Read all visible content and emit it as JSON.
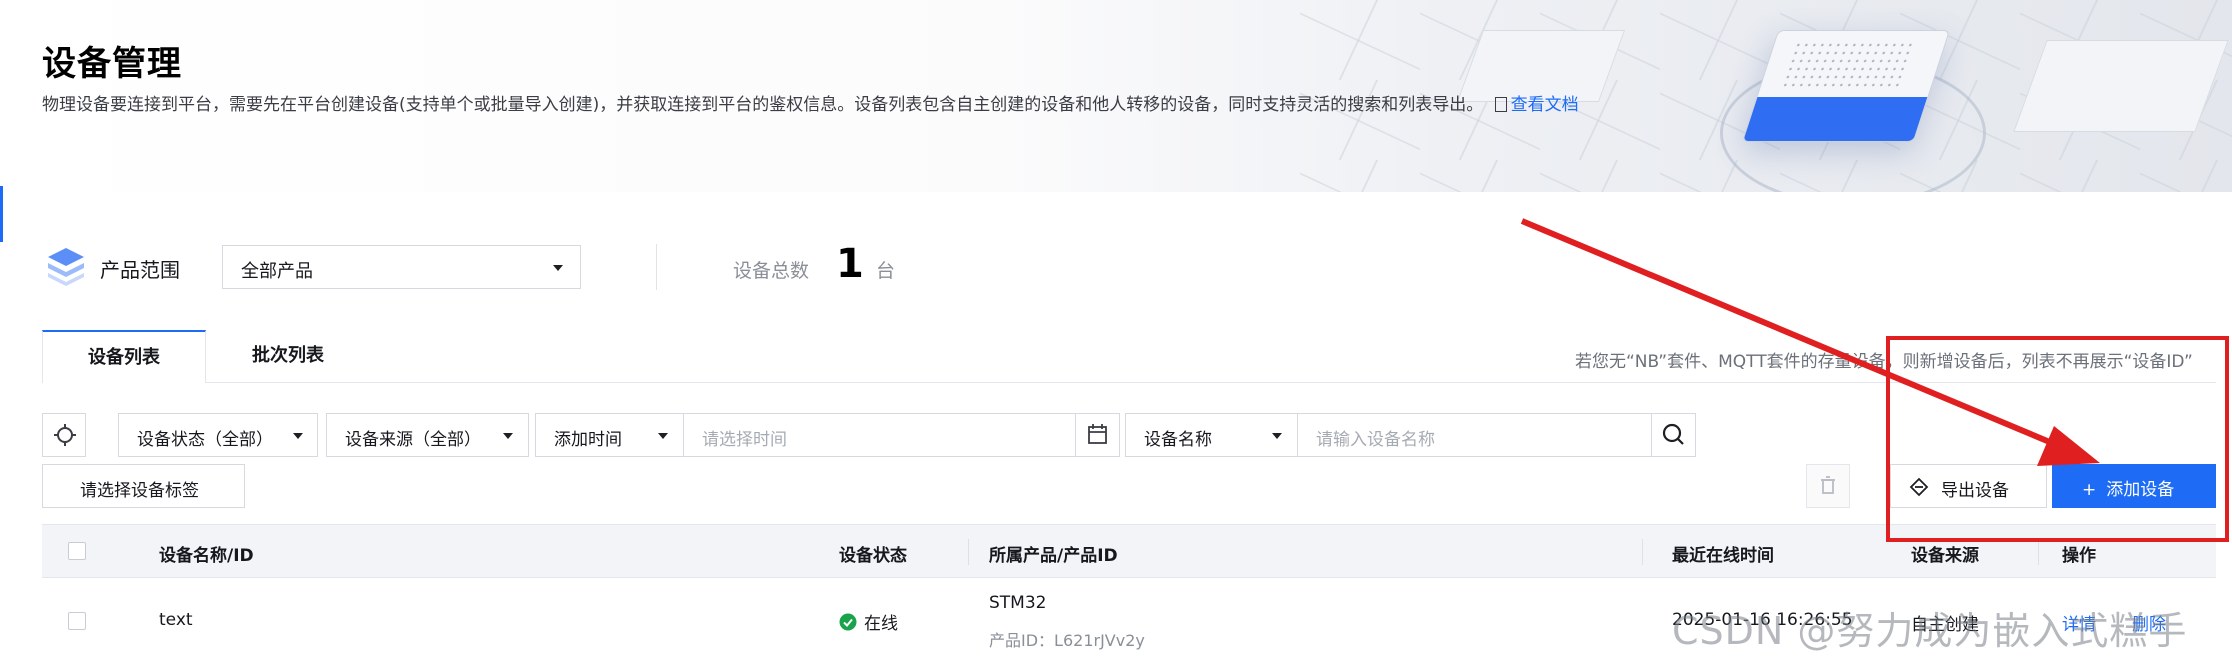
{
  "header": {
    "title": "设备管理",
    "description": "物理设备要连接到平台，需要先在平台创建设备(支持单个或批量导入创建)，并获取连接到平台的鉴权信息。设备列表包含自主创建的设备和他人转移的设备，同时支持灵活的搜索和列表导出。",
    "doc_link": "查看文档",
    "doc_icon": "document-icon"
  },
  "product_range": {
    "label": "产品范围",
    "selected": "全部产品",
    "total_label": "设备总数",
    "total_count": "1",
    "total_unit": "台"
  },
  "tabs": [
    {
      "label": "设备列表",
      "active": true
    },
    {
      "label": "批次列表",
      "active": false
    }
  ],
  "notice": "若您无“NB”套件、MQTT套件的存量设备，则新增设备后，列表不再展示“设备ID”",
  "filters": {
    "status": "设备状态（全部）",
    "source": "设备来源（全部）",
    "time_field": "添加时间",
    "time_placeholder": "请选择时间",
    "name_field": "设备名称",
    "name_placeholder": "请输入设备名称"
  },
  "actions": {
    "tag_select": "请选择设备标签",
    "export": "导出设备",
    "add": "添加设备"
  },
  "table": {
    "columns": [
      "设备名称/ID",
      "设备状态",
      "所属产品/产品ID",
      "最近在线时间",
      "设备来源",
      "操作"
    ],
    "rows": [
      {
        "name": "text",
        "status": "在线",
        "product": "STM32",
        "product_id": "产品ID：L621rJVv2y",
        "last_online": "2025-01-16 16:26:55",
        "source": "自主创建",
        "op_detail": "详情",
        "op_delete": "删除"
      }
    ]
  },
  "watermark": "CSDN @努力成为嵌入式糕手",
  "colors": {
    "accent": "#1e6cf5",
    "online": "#1aa34a",
    "annotation_red": "#e02020"
  }
}
